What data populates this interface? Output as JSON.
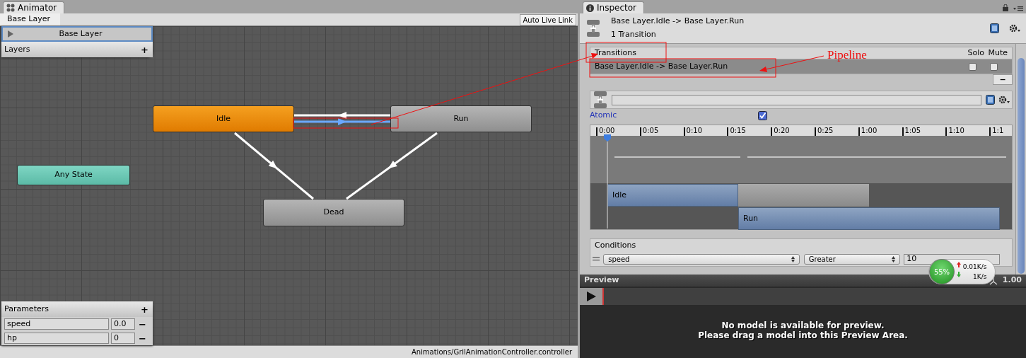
{
  "animator": {
    "tab": "Animator",
    "breadcrumb": "Base Layer",
    "auto_live_link": "Auto Live Link",
    "layers": {
      "items": [
        {
          "name": "Base Layer",
          "selected": true
        }
      ],
      "title": "Layers",
      "add": "+"
    },
    "states": [
      {
        "name": "Idle",
        "kind": "default"
      },
      {
        "name": "Run",
        "kind": "normal"
      },
      {
        "name": "Any State",
        "kind": "any"
      },
      {
        "name": "Dead",
        "kind": "normal"
      }
    ],
    "transitions": [
      {
        "selected": false
      },
      {
        "selected": true
      },
      {
        "selected": false
      },
      {
        "selected": false
      }
    ],
    "parameters": {
      "title": "Parameters",
      "add": "+",
      "items": [
        {
          "name": "speed",
          "value": "0.0",
          "remove": "−"
        },
        {
          "name": "hp",
          "value": "0",
          "remove": "−"
        }
      ]
    },
    "status_bar": "Animations/GrilAnimationController.controller"
  },
  "inspector": {
    "tab": "Inspector",
    "title": "Base Layer.Idle -> Base Layer.Run",
    "subtitle": "1 Transition",
    "transitions": {
      "title": "Transitions",
      "solo": "Solo",
      "mute": "Mute",
      "remove": "−",
      "rows": [
        {
          "label": "Base Layer.Idle -> Base Layer.Run",
          "solo": false,
          "mute": false,
          "selected": true
        }
      ]
    },
    "atomic": {
      "label": "Atomic",
      "checked": true
    },
    "timeline": {
      "ticks": [
        "0:00",
        "0:05",
        "0:10",
        "0:15",
        "0:20",
        "0:25",
        "1:00",
        "1:05",
        "1:10",
        "1:1"
      ],
      "clips": [
        {
          "name": "Idle"
        },
        {
          "name": "Run"
        }
      ]
    },
    "conditions": {
      "title": "Conditions",
      "rows": [
        {
          "parameter": "speed",
          "mode": "Greater",
          "value": "10"
        }
      ]
    },
    "preview": {
      "title": "Preview",
      "speed": "1.00",
      "message": [
        "No model is available for preview.",
        "Please drag a model into this Preview Area."
      ]
    }
  },
  "network_widget": {
    "percent": "55%",
    "upload": "0.01K/s",
    "download": "1K/s"
  },
  "annotation": {
    "label": "Pipeline"
  }
}
